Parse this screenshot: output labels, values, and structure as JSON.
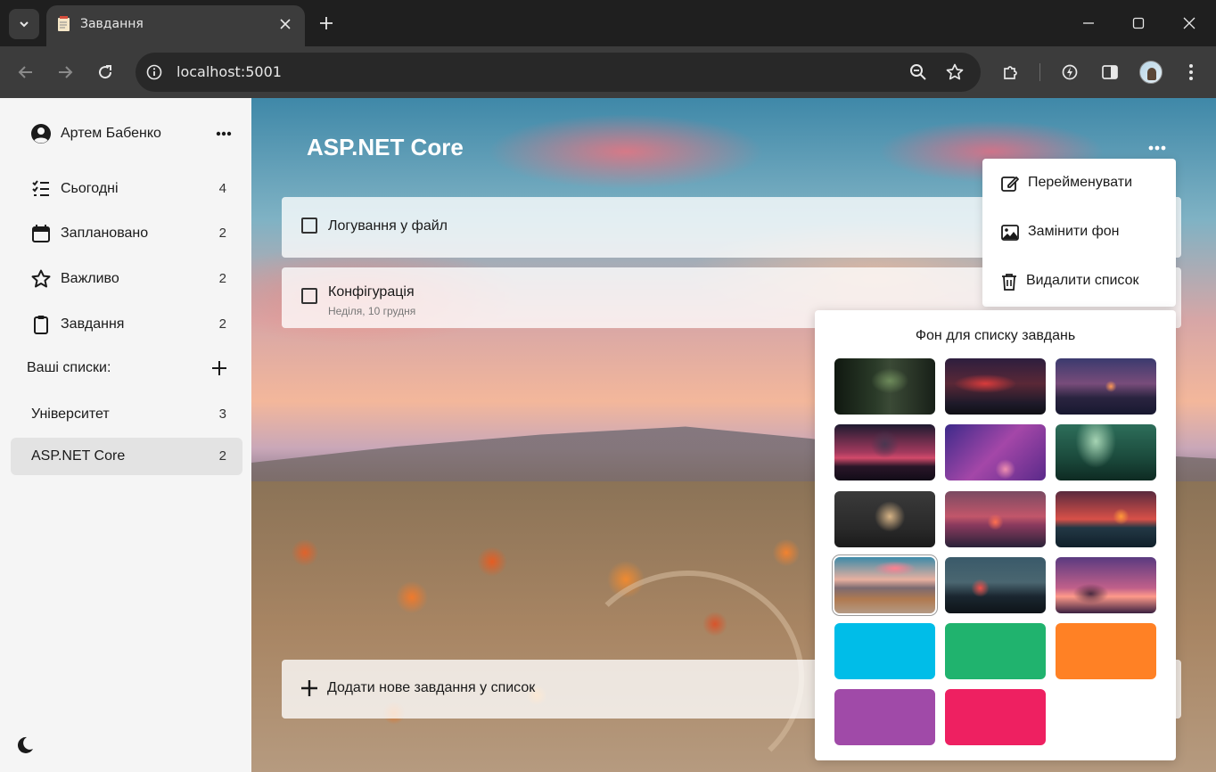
{
  "browser": {
    "tab_title": "Завдання",
    "url": "localhost:5001"
  },
  "sidebar": {
    "user_name": "Артем Бабенко",
    "nav": [
      {
        "label": "Сьогодні",
        "count": "4",
        "icon": "checklist-icon"
      },
      {
        "label": "Заплановано",
        "count": "2",
        "icon": "calendar-icon"
      },
      {
        "label": "Важливо",
        "count": "2",
        "icon": "star-icon"
      },
      {
        "label": "Завдання",
        "count": "2",
        "icon": "clipboard-icon"
      }
    ],
    "lists_heading": "Ваші списки:",
    "lists": [
      {
        "label": "Університет",
        "count": "3",
        "selected": false
      },
      {
        "label": "ASP.NET Core",
        "count": "2",
        "selected": true
      }
    ]
  },
  "main": {
    "list_title": "ASP.NET Core",
    "tasks": [
      {
        "title": "Логування у файл",
        "subtitle": ""
      },
      {
        "title": "Конфігурація",
        "subtitle": "Неділя, 10 грудня"
      }
    ],
    "add_task_label": "Додати нове завдання у список"
  },
  "menu": {
    "items": [
      {
        "label": "Перейменувати",
        "icon": "edit-icon"
      },
      {
        "label": "Замінити фон",
        "icon": "image-icon"
      },
      {
        "label": "Видалити список",
        "icon": "trash-icon"
      }
    ]
  },
  "background_picker": {
    "title": "Фон для списку завдань",
    "solid_colors": [
      "#00bde8",
      "#20b36e",
      "#ff8125",
      "#a04aa8",
      "#ee2061"
    ],
    "selected_index": 9
  }
}
